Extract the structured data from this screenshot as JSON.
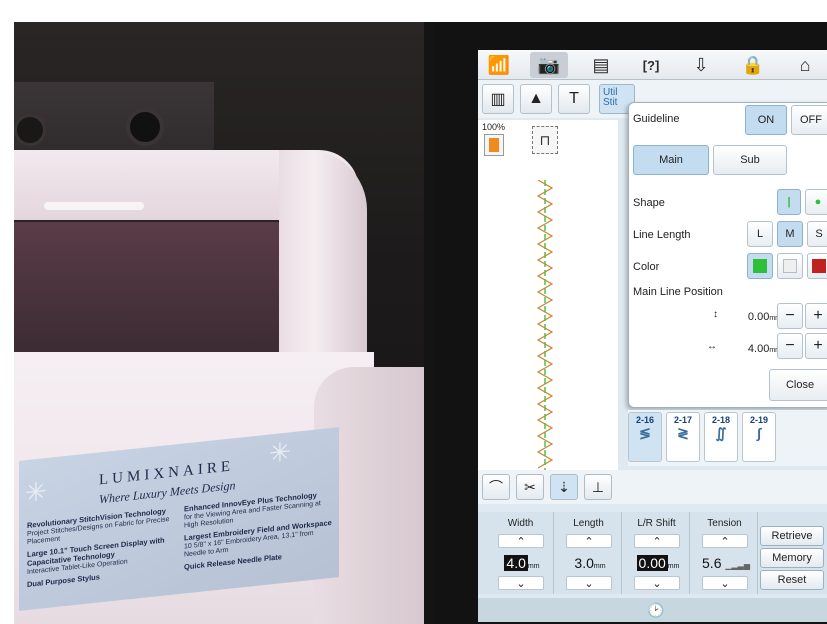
{
  "label": {
    "brand": "LUMIXNAIRE",
    "tagline": "Where Luxury Meets Design",
    "features_left": [
      {
        "title": "Revolutionary StitchVision Technology",
        "sub": "Project Stitches/Designs on Fabric for Precise Placement"
      },
      {
        "title": "Large 10.1\" Touch Screen Display with Capacitative Technology",
        "sub": "Interactive Tablet-Like Operation"
      },
      {
        "title": "Dual Purpose Stylus",
        "sub": ""
      }
    ],
    "features_right": [
      {
        "title": "Enhanced InnovEye Plus Technology",
        "sub": "for the Viewing Area and Faster Scanning at High Resolution"
      },
      {
        "title": "Largest Embroidery Field and Workspace",
        "sub": "10 5/8\" x 16\" Embroidery Area, 13.1\" from Needle to Arm"
      },
      {
        "title": "Quick Release Needle Plate",
        "sub": ""
      }
    ]
  },
  "screen": {
    "topbar_icons": [
      "wifi-icon",
      "camera-icon",
      "document-icon",
      "help-icon",
      "thread-icon",
      "lock-icon",
      "home-icon"
    ],
    "toolbar_util": "Util Stit",
    "zoom": "100%",
    "guideline": {
      "label": "Guideline",
      "on": "ON",
      "off": "OFF",
      "tabs": [
        "Main",
        "Sub"
      ],
      "shape_label": "Shape",
      "line_length_label": "Line Length",
      "line_lengths": [
        "L",
        "M",
        "S"
      ],
      "color_label": "Color",
      "colors": [
        "#2fbf3a",
        "#efefef",
        "#c0231f"
      ],
      "main_line_position_label": "Main Line Position",
      "pos1_value": "0.00",
      "pos2_value": "4.00",
      "unit": "mm",
      "close": "Close"
    },
    "stitches": [
      "2-16",
      "2-17",
      "2-18",
      "2-19"
    ],
    "settings": [
      {
        "title": "Width",
        "value": "4.0",
        "unit": "mm"
      },
      {
        "title": "Length",
        "value": "3.0",
        "unit": "mm"
      },
      {
        "title": "L/R Shift",
        "value": "0.00",
        "unit": "mm"
      },
      {
        "title": "Tension",
        "value": "5.6",
        "unit": ""
      }
    ],
    "buttons": {
      "retrieve": "Retrieve",
      "memory": "Memory",
      "reset": "Reset"
    }
  }
}
